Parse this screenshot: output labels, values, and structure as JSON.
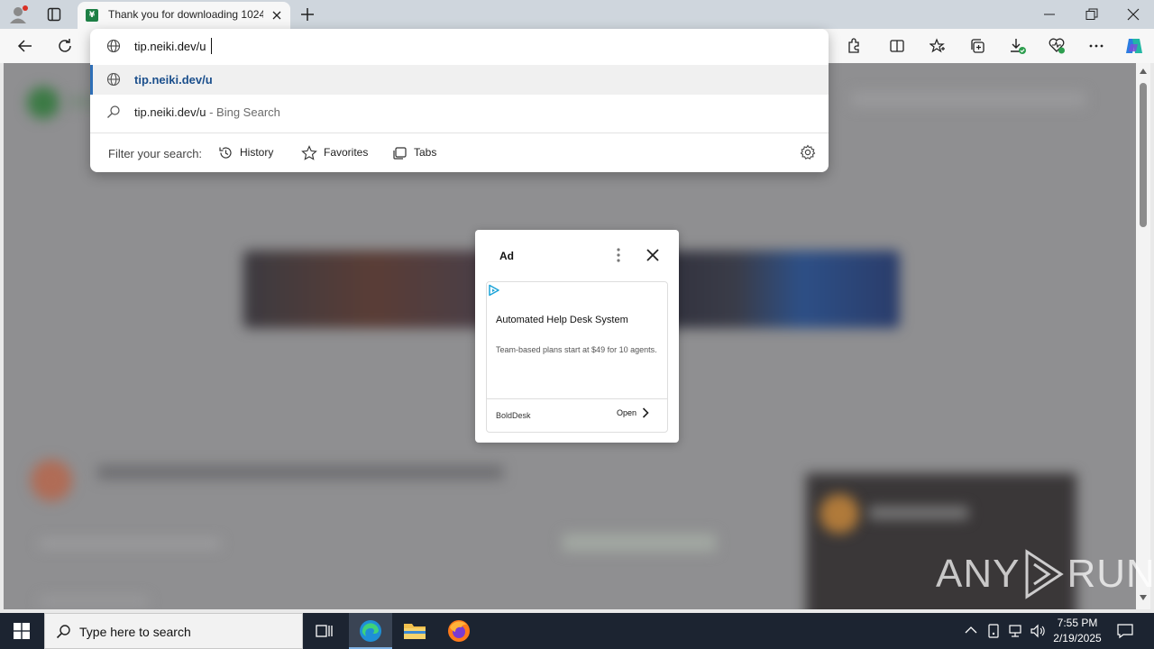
{
  "browser": {
    "tab_title": "Thank you for downloading 1024",
    "favicon_letter": "¥",
    "address_value": "tip.neiki.dev/u"
  },
  "omnibox": {
    "suggestions": [
      {
        "text": "tip.neiki.dev/u",
        "icon": "globe-icon"
      },
      {
        "text": "tip.neiki.dev/u",
        "suffix": " - Bing Search",
        "icon": "search-icon"
      }
    ],
    "filter_label": "Filter your search:",
    "filters": [
      {
        "label": "History",
        "icon": "history-icon"
      },
      {
        "label": "Favorites",
        "icon": "star-icon"
      },
      {
        "label": "Tabs",
        "icon": "tabs-icon"
      }
    ]
  },
  "ad": {
    "label": "Ad",
    "title": "Automated Help Desk System",
    "description": "Team-based plans start at $49 for 10 agents.",
    "brand": "BoldDesk",
    "cta": "Open"
  },
  "watermark": {
    "text_left": "ANY",
    "text_right": "RUN"
  },
  "taskbar": {
    "search_placeholder": "Type here to search",
    "time": "7:55 PM",
    "date": "2/19/2025"
  },
  "colors": {
    "accent": "#2f6fb7",
    "suggestion_text": "#1b4f8c",
    "taskbar": "#1c2431"
  }
}
